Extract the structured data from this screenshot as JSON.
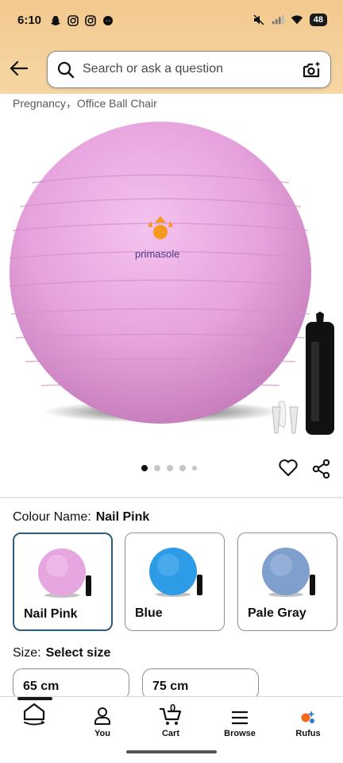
{
  "status_bar": {
    "time": "6:10",
    "battery": "48",
    "left_icons": [
      "snapchat-icon",
      "instagram-icon",
      "instagram-icon",
      "messenger-icon"
    ],
    "right_icons": [
      "mute-icon",
      "signal-icon",
      "wifi-icon",
      "battery-icon"
    ]
  },
  "header": {
    "search_placeholder": "Search or ask a question",
    "band_color": "#f4cf9a"
  },
  "breadcrumb": "Pregnancy，Office Ball Chair",
  "product": {
    "brand_text": "primasole",
    "image_dots": {
      "count": 5,
      "active_index": 0
    }
  },
  "colour": {
    "label": "Colour Name:",
    "value": "Nail Pink",
    "options": [
      {
        "name": "Nail Pink",
        "color": "#e6a6df",
        "selected": true
      },
      {
        "name": "Blue",
        "color": "#2e9be6",
        "selected": false
      },
      {
        "name": "Pale Gray",
        "color": "#7f9fcc",
        "selected": false
      }
    ]
  },
  "size": {
    "label": "Size:",
    "value": "Select size",
    "options": [
      "65 cm",
      "75 cm"
    ]
  },
  "bottom_nav": {
    "items": [
      {
        "label": "",
        "icon": "home-icon"
      },
      {
        "label": "You",
        "icon": "person-icon"
      },
      {
        "label": "Cart",
        "icon": "cart-icon",
        "badge": "0"
      },
      {
        "label": "Browse",
        "icon": "menu-icon"
      },
      {
        "label": "Rufus",
        "icon": "rufus-icon"
      }
    ]
  },
  "colors": {
    "accent_selected_border": "#2e5c7c",
    "text": "#0f1111"
  }
}
